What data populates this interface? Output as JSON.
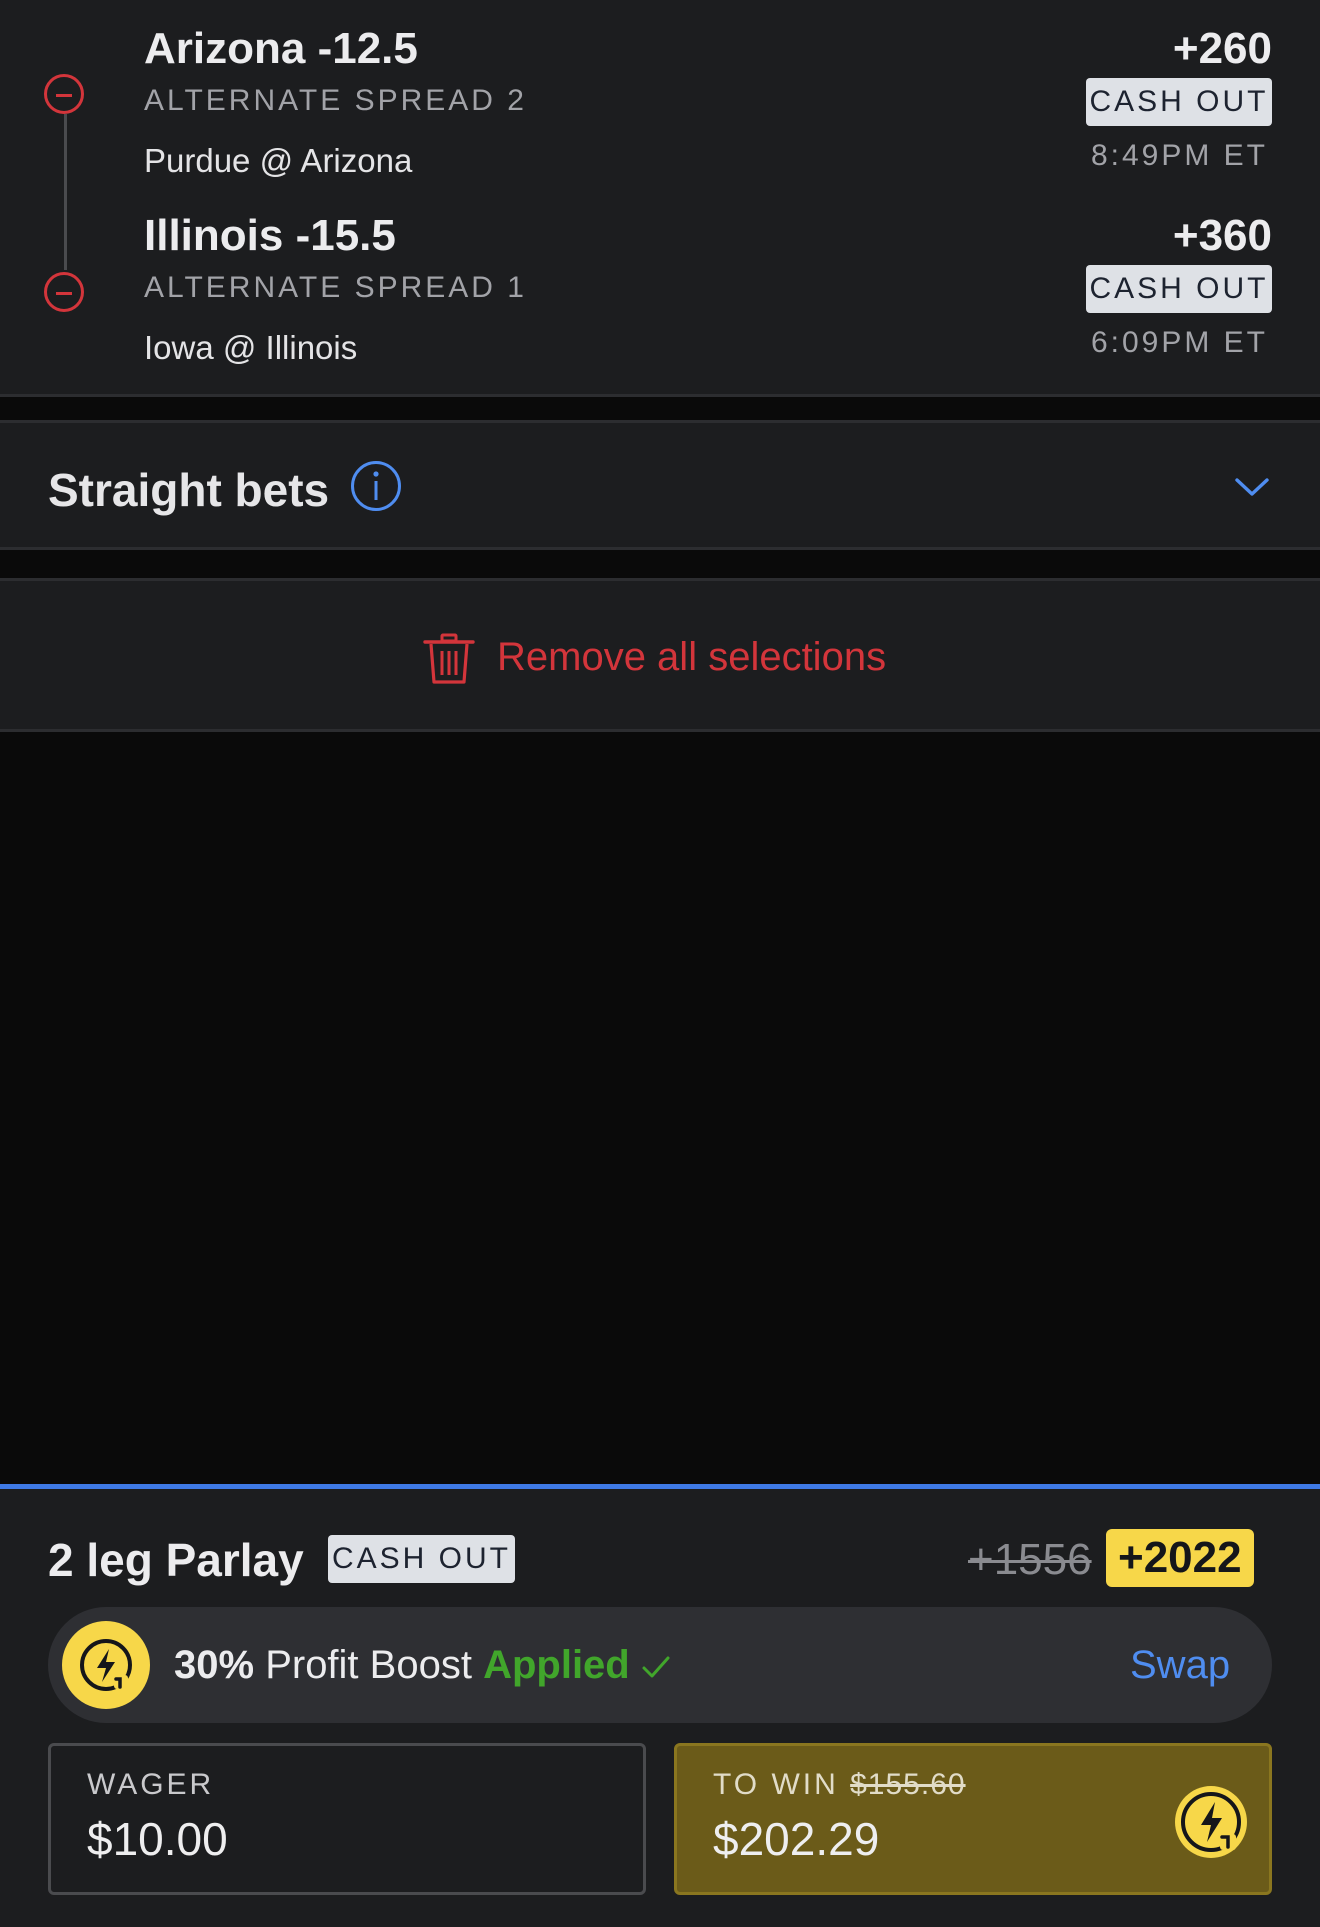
{
  "legs": [
    {
      "title": "Arizona -12.5",
      "market": "ALTERNATE SPREAD 2",
      "matchup": "Purdue @ Arizona",
      "odds": "+260",
      "cashout_label": "CASH OUT",
      "time": "8:49PM ET"
    },
    {
      "title": "Illinois -15.5",
      "market": "ALTERNATE SPREAD 1",
      "matchup": "Iowa @ Illinois",
      "odds": "+360",
      "cashout_label": "CASH OUT",
      "time": "6:09PM ET"
    }
  ],
  "straight_bets": {
    "title": "Straight bets"
  },
  "remove_all": {
    "label": "Remove all selections"
  },
  "parlay": {
    "title": "2 leg Parlay",
    "cashout_label": "CASH OUT",
    "old_odds": "+1556",
    "new_odds": "+2022",
    "boost": {
      "percent": "30%",
      "text": "Profit Boost",
      "status": "Applied",
      "swap_label": "Swap"
    },
    "wager": {
      "label": "WAGER",
      "value": "$10.00"
    },
    "to_win": {
      "label": "TO WIN",
      "old_value": "$155.60",
      "value": "$202.29"
    }
  },
  "colors": {
    "accent_blue": "#3f7ae6",
    "remove_red": "#d3353b",
    "boost_yellow": "#f7d749",
    "applied_green": "#41a62b"
  },
  "icons": [
    "remove-leg-icon",
    "info-icon",
    "chevron-down-icon",
    "trash-icon",
    "profit-boost-icon",
    "checkmark-icon"
  ]
}
